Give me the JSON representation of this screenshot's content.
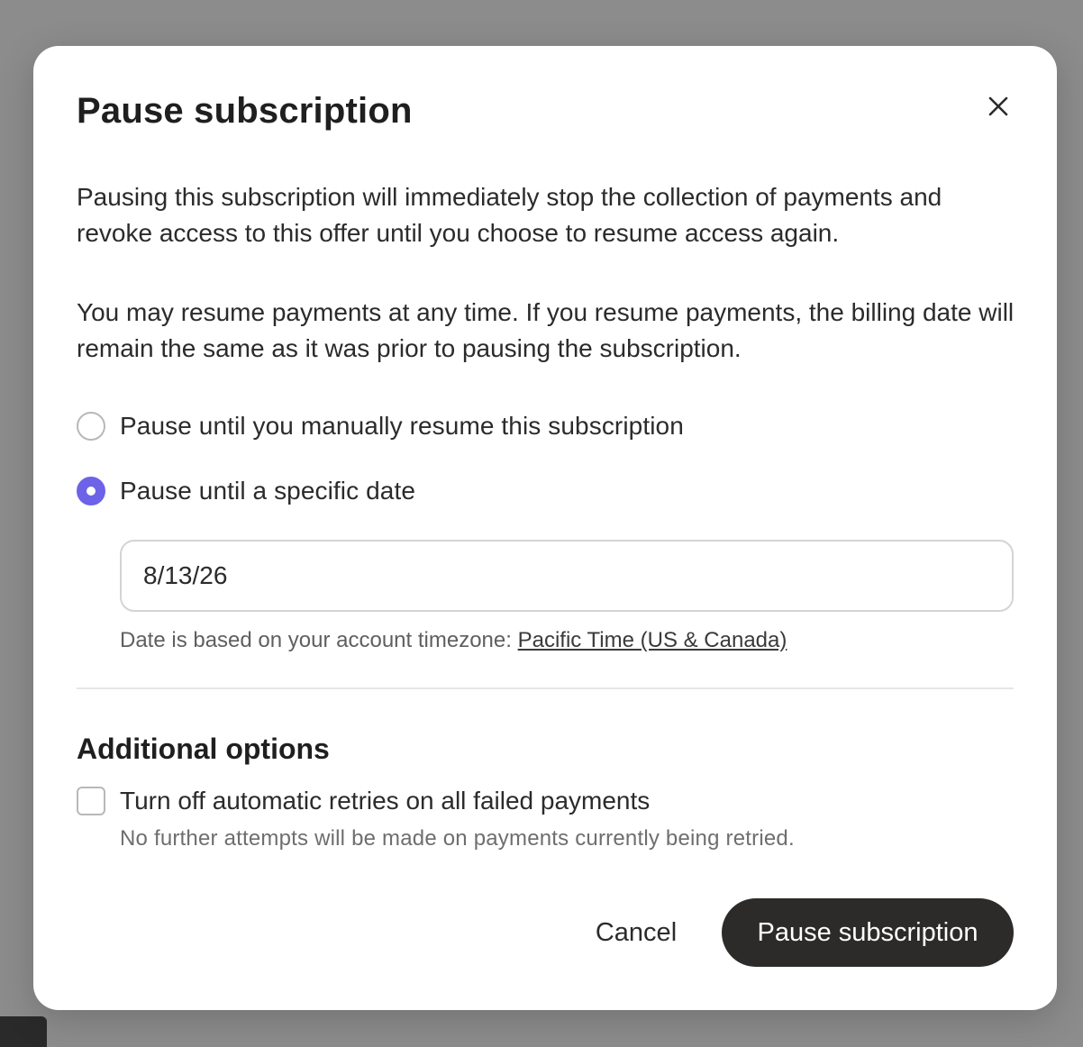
{
  "modal": {
    "title": "Pause subscription",
    "close_icon": "close-icon",
    "description_1": "Pausing this subscription will immediately stop the collection of payments and revoke access to this offer until you choose to resume access again.",
    "description_2": "You may resume payments at any time. If you resume payments, the billing date will remain the same as it was prior to pausing the subscription.",
    "pause_options": [
      {
        "label": "Pause until you manually resume this subscription",
        "selected": false
      },
      {
        "label": "Pause until a specific date",
        "selected": true
      }
    ],
    "date_input": {
      "value": "8/13/26"
    },
    "timezone_note": {
      "prefix": "Date is based on your account timezone: ",
      "link_text": "Pacific Time (US & Canada)"
    },
    "additional_options": {
      "title": "Additional options",
      "retries_checkbox": {
        "label": "Turn off automatic retries on all failed payments",
        "checked": false,
        "help": "No further attempts will be made on payments currently being retried."
      }
    },
    "buttons": {
      "cancel": "Cancel",
      "confirm": "Pause subscription"
    }
  },
  "colors": {
    "accent": "#6c63e8",
    "primary_button": "#2d2b2a",
    "overlay": "#8a8a8a"
  }
}
